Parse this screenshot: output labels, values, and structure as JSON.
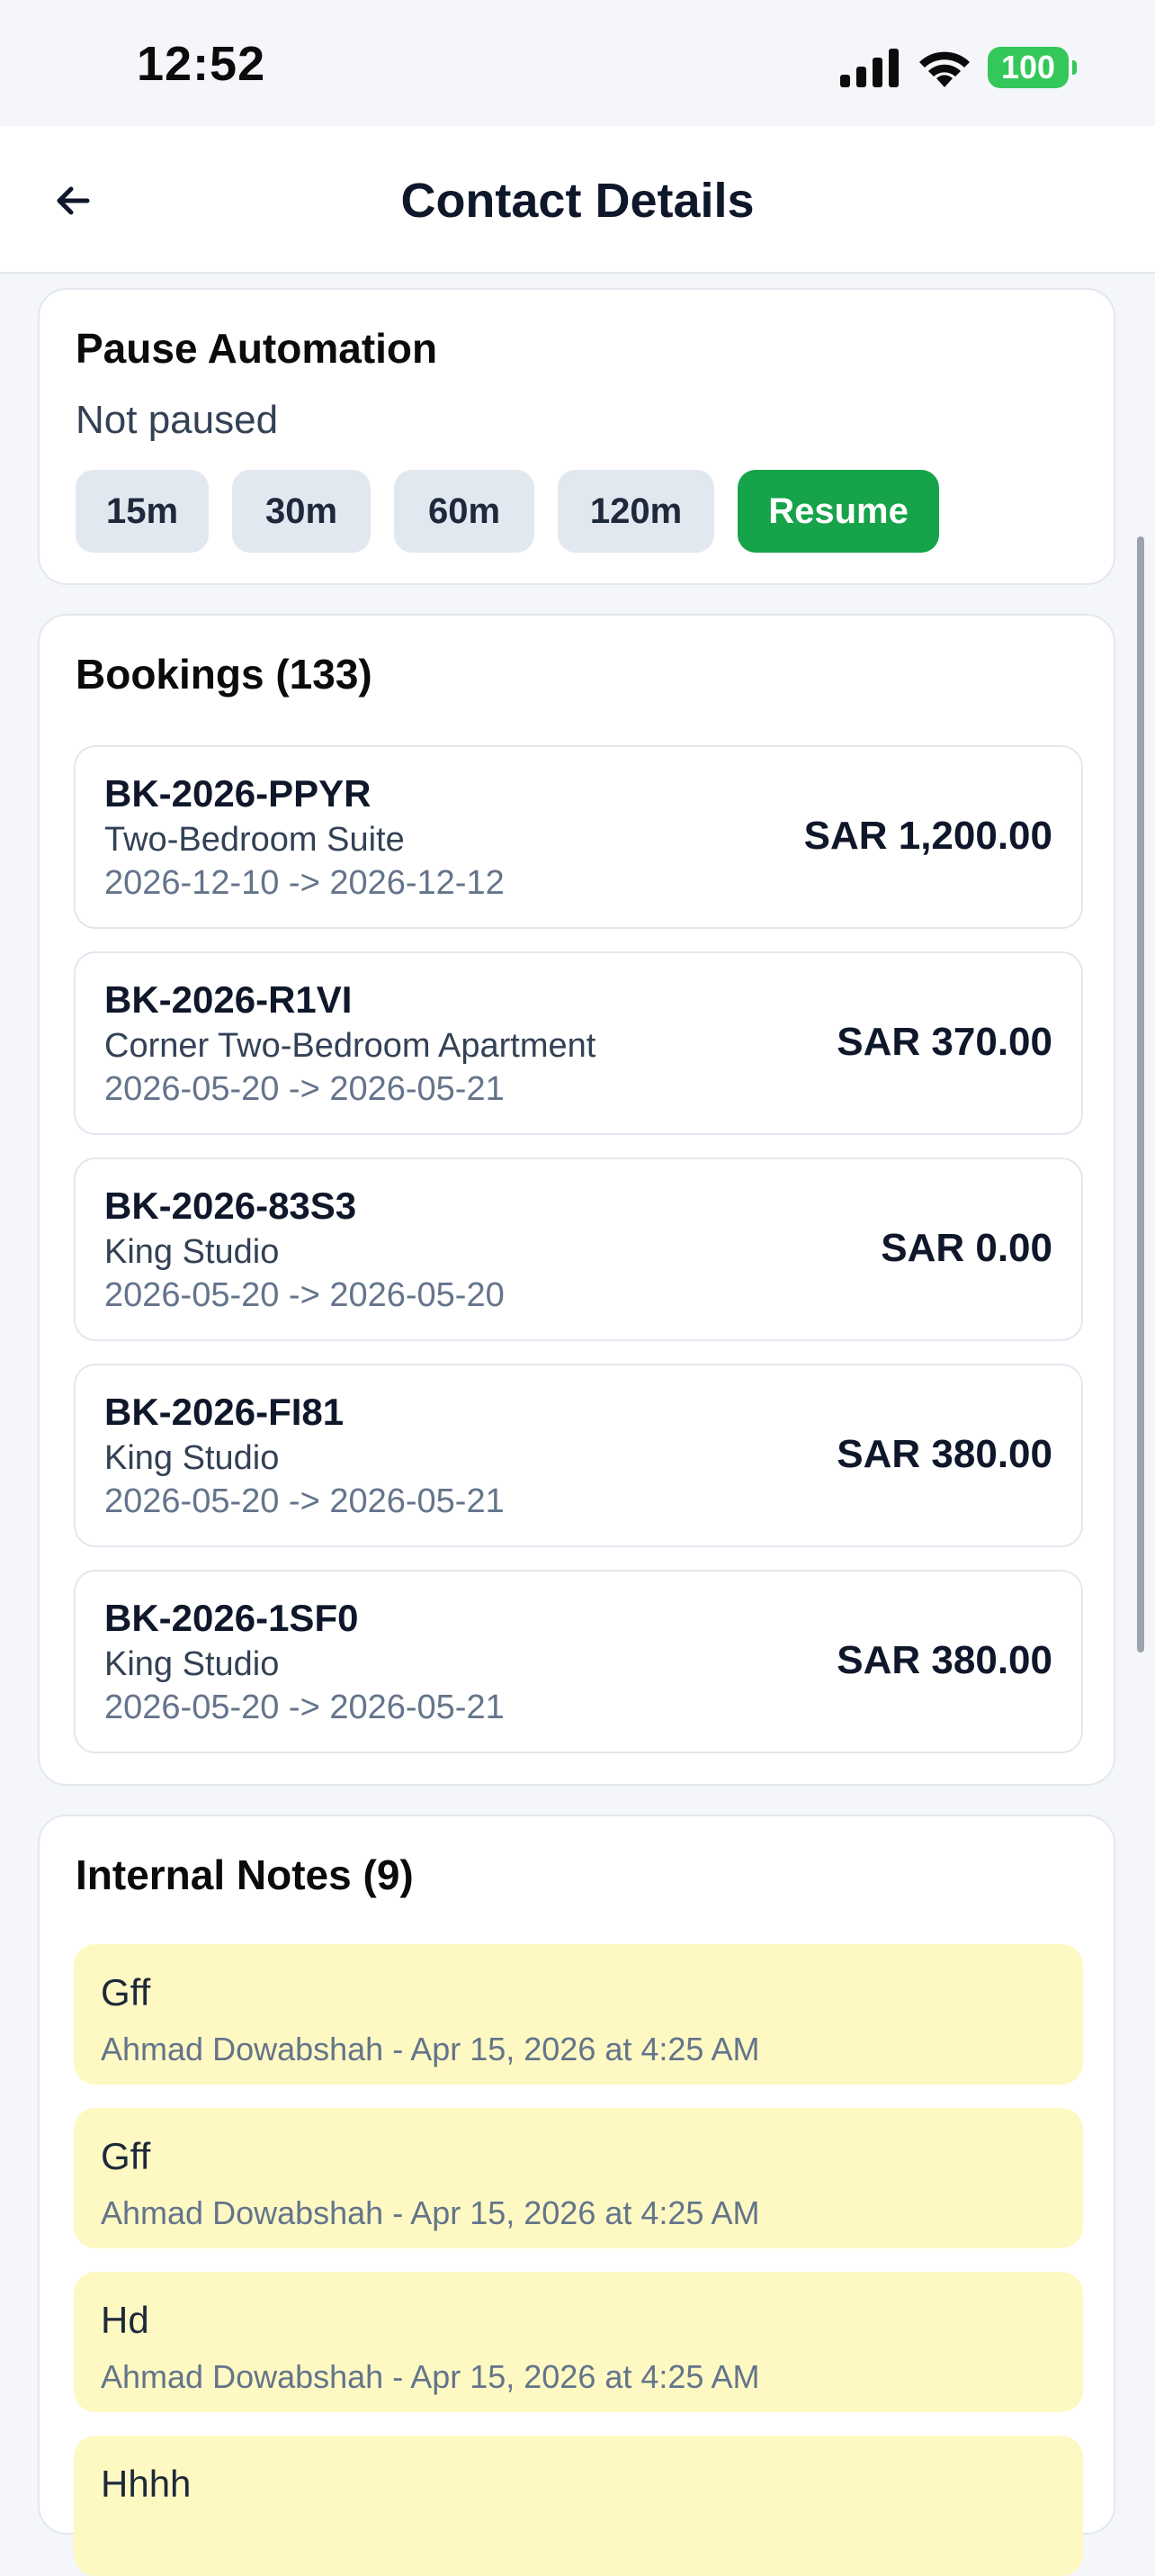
{
  "status_bar": {
    "time": "12:52",
    "battery": "100"
  },
  "header": {
    "title": "Contact Details"
  },
  "pause_automation": {
    "title": "Pause Automation",
    "status": "Not paused",
    "buttons": [
      "15m",
      "30m",
      "60m",
      "120m"
    ],
    "resume_label": "Resume"
  },
  "bookings": {
    "title": "Bookings (133)",
    "items": [
      {
        "id": "BK-2026-PPYR",
        "room": "Two-Bedroom Suite",
        "dates": "2026-12-10 -> 2026-12-12",
        "amount": "SAR 1,200.00"
      },
      {
        "id": "BK-2026-R1VI",
        "room": "Corner Two-Bedroom Apartment",
        "dates": "2026-05-20 -> 2026-05-21",
        "amount": "SAR 370.00"
      },
      {
        "id": "BK-2026-83S3",
        "room": "King Studio",
        "dates": "2026-05-20 -> 2026-05-20",
        "amount": "SAR 0.00"
      },
      {
        "id": "BK-2026-FI81",
        "room": "King Studio",
        "dates": "2026-05-20 -> 2026-05-21",
        "amount": "SAR 380.00"
      },
      {
        "id": "BK-2026-1SF0",
        "room": "King Studio",
        "dates": "2026-05-20 -> 2026-05-21",
        "amount": "SAR 380.00"
      }
    ]
  },
  "notes": {
    "title": "Internal Notes (9)",
    "items": [
      {
        "text": "Gff",
        "meta": "Ahmad Dowabshah - Apr 15, 2026 at 4:25 AM"
      },
      {
        "text": "Gff",
        "meta": "Ahmad Dowabshah - Apr 15, 2026 at 4:25 AM"
      },
      {
        "text": "Hd",
        "meta": "Ahmad Dowabshah - Apr 15, 2026 at 4:25 AM"
      },
      {
        "text": "Hhhh",
        "meta": ""
      }
    ]
  },
  "colors": {
    "accent_green": "#16a34a",
    "note_bg": "#fef9c3",
    "battery_green": "#34c759"
  },
  "icons": [
    "back-arrow-icon",
    "cellular-signal-icon",
    "wifi-icon",
    "battery-icon"
  ]
}
